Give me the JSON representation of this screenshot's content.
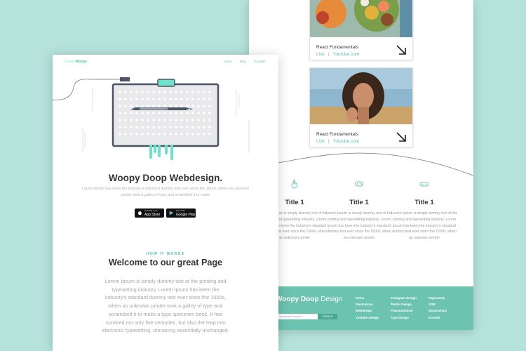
{
  "colors": {
    "background": "#b5e3dc",
    "accent": "#55bfae",
    "footer": "#6cc3b0"
  },
  "back_page": {
    "cards": [
      {
        "title": "React Fundamentals",
        "link_label": "Link",
        "source_label": "Youtube.com",
        "image": "food-photo",
        "icon": "arrow-down-right-icon"
      },
      {
        "title": "React Fundamentals",
        "link_label": "Link",
        "source_label": "Youtube.com",
        "image": "woman-portrait-photo",
        "icon": "arrow-down-right-icon"
      }
    ],
    "features": [
      {
        "icon": "flame-icon",
        "title": "Title 1",
        "text": "Lorem Ipsum is simply dummy text of the printing and typesetting industry. Lorem Ipsum has been the industry's standard dummy text ever since the 1500s, when an unknown printer"
      },
      {
        "icon": "gamepad-icon",
        "title": "Title 1",
        "text": "Lorem Ipsum is simply dummy text of the printing and typesetting industry. Lorem Ipsum has been the industry's standard dummy text ever since the 1500s, when an unknown printer"
      },
      {
        "icon": "controller-icon",
        "title": "Title 1",
        "text": "Lorem Ipsum is simply dummy text of the printing and typesetting industry. Lorem Ipsum has been the industry's standard dummy text ever since the 1500s, when an unknown printer"
      }
    ],
    "footer": {
      "logo_bold": "Woopy Doop",
      "logo_light": " Design",
      "search_placeholder": "Suchbegriff eingeben",
      "search_button": "SEARCH",
      "col1": [
        "Home",
        "Illustrations",
        "Webdesign",
        "Youtube Design"
      ],
      "col2": [
        "Instagram Design",
        "Twitter Design",
        "Präsentationen",
        "Type Design"
      ],
      "col3": [
        "Impressum",
        "AGB",
        "Datenschutz",
        "Kontakt"
      ]
    }
  },
  "front_page": {
    "brand_light": "Design",
    "brand_bold": "Woopy",
    "nav": [
      "Home",
      "Blog",
      "Kontakt"
    ],
    "hero_icon": "drawing-tablet-pen-illustration",
    "hero_title": "Woopy Doop Webdesign.",
    "hero_subtitle": "Lorem Ipsum has been the industry's standard dummy text ever since the 1500s, when an unknown printer took a galley of type and scrambled it to make",
    "app_store": {
      "small": "Download on the",
      "big": "App Store",
      "icon": "apple-icon"
    },
    "google_play": {
      "small": "GET IT ON",
      "big": "Google Play",
      "icon": "google-play-icon"
    },
    "kicker": "HOW IT WORKS",
    "welcome_title": "Welcome to our great Page",
    "welcome_text": "Lorem Ipsum is simply dummy text of the printing and typesetting industry. Lorem Ipsum has been the industry's standard dummy text ever since the 1500s, when an unknown printer took a galley of type and scrambled it to make a type specimen book. It has survived not only five centuries, but also the leap into electronic typesetting, remaining essentially unchanged."
  }
}
